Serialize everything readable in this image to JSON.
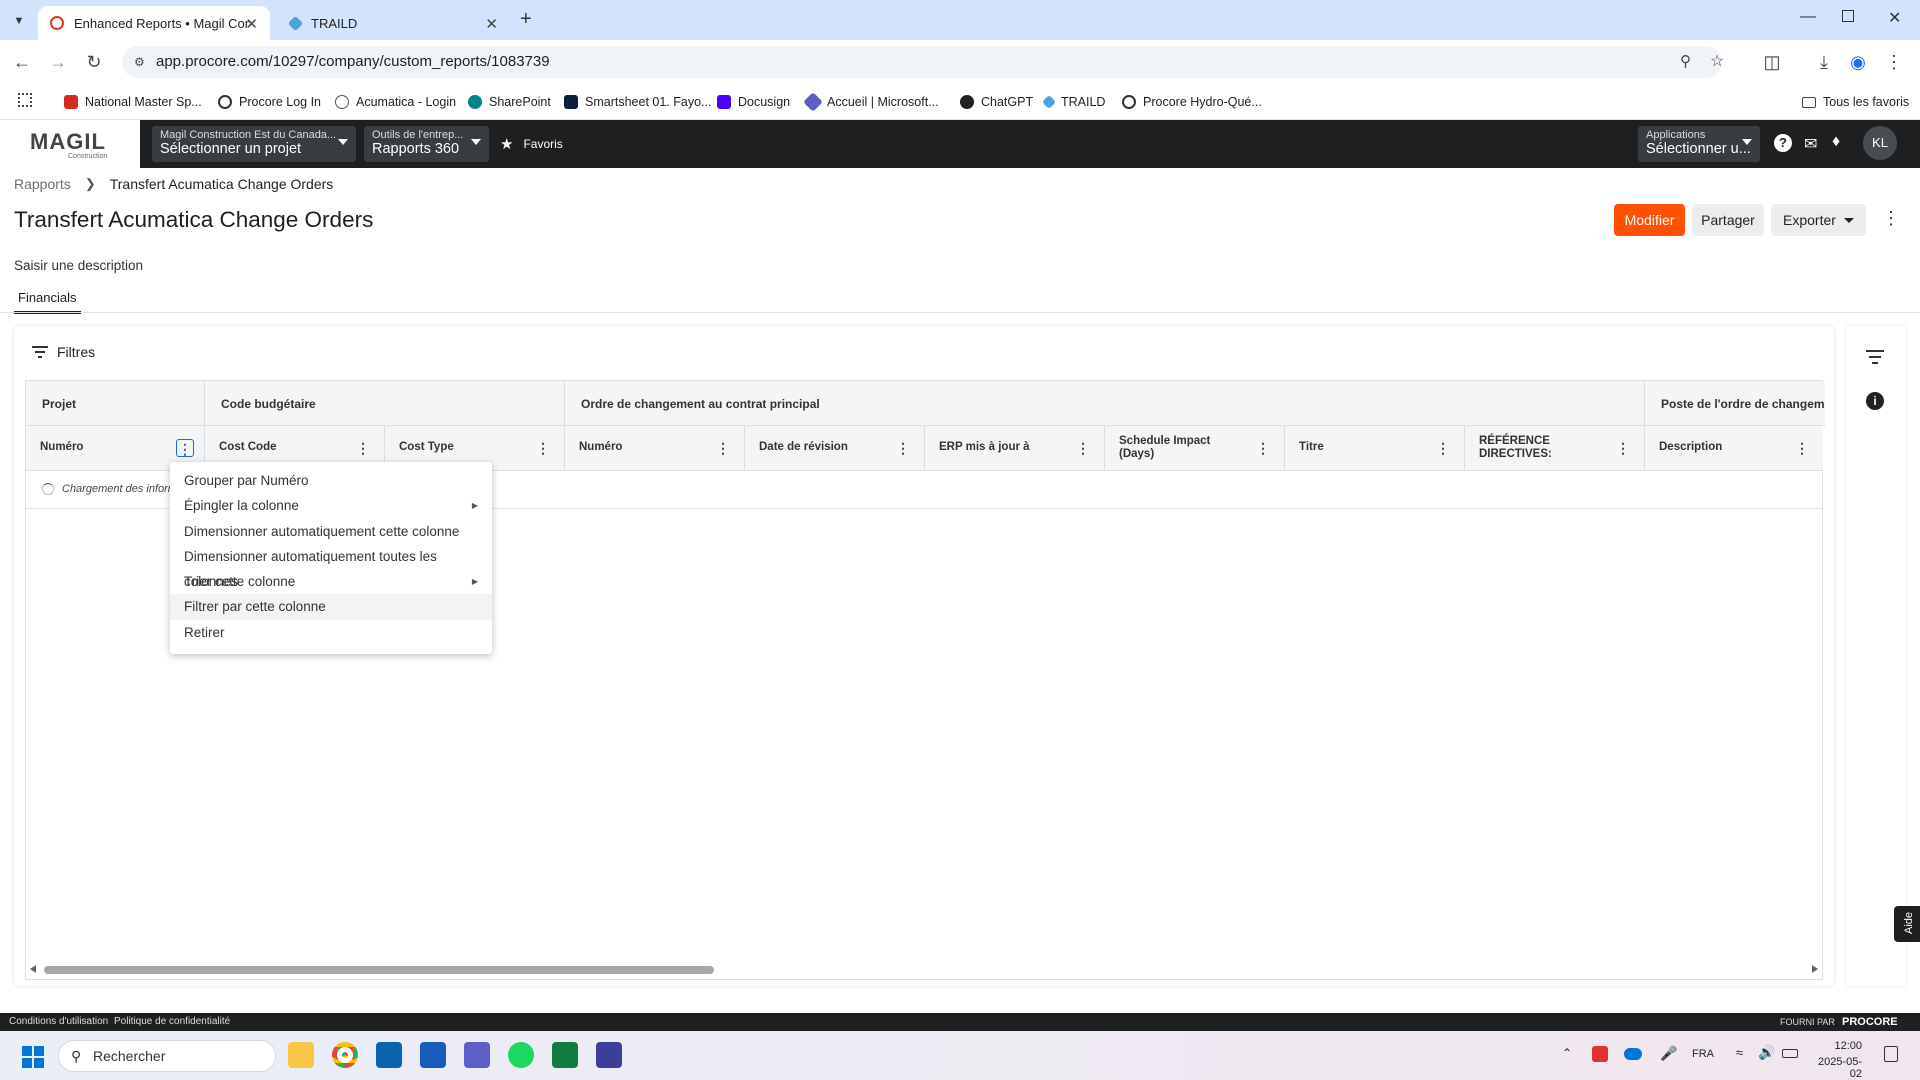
{
  "browser": {
    "tabs": [
      {
        "title": "Enhanced Reports • Magil Cons",
        "active": true
      },
      {
        "title": "TRAILD",
        "active": false
      }
    ],
    "url": "app.procore.com/10297/company/custom_reports/1083739",
    "bookmarks": [
      "National Master Sp...",
      "Procore Log In",
      "Acumatica - Login",
      "SharePoint",
      "Smartsheet 01. Fayo...",
      "Docusign",
      "Accueil | Microsoft...",
      "ChatGPT",
      "TRAILD",
      "Procore Hydro-Qué..."
    ],
    "all_bookmarks": "Tous les favoris"
  },
  "procore_header": {
    "logo_text": "MAGIL",
    "logo_sub": "Construction",
    "company_label": "Magil Construction Est du Canada...",
    "project_value": "Sélectionner un projet",
    "tools_label": "Outils de l'entrep...",
    "tools_value": "Rapports 360",
    "favorites": "Favoris",
    "apps_label": "Applications",
    "apps_value": "Sélectionner u...",
    "avatar": "KL"
  },
  "page": {
    "breadcrumb_root": "Rapports",
    "breadcrumb_current": "Transfert Acumatica Change Orders",
    "title": "Transfert Acumatica Change Orders",
    "description_placeholder": "Saisir une description",
    "tab": "Financials",
    "buttons": {
      "edit": "Modifier",
      "share": "Partager",
      "export": "Exporter"
    }
  },
  "report": {
    "filters_label": "Filtres",
    "group_headers": [
      "Projet",
      "Code budgétaire",
      "Ordre de changement au contrat principal",
      "Poste de l'ordre de changemen"
    ],
    "columns": [
      "Numéro",
      "Cost Code",
      "Cost Type",
      "Numéro",
      "Date de révision",
      "ERP mis à jour à",
      "Schedule Impact (Days)",
      "Titre",
      "RÉFÉRENCE DIRECTIVES:",
      "Description"
    ],
    "loading_text": "Chargement des inform"
  },
  "column_menu": [
    {
      "label": "Grouper par Numéro",
      "submenu": false
    },
    {
      "label": "Épingler la colonne",
      "submenu": true
    },
    {
      "label": "Dimensionner automatiquement cette colonne",
      "submenu": false
    },
    {
      "label": "Dimensionner automatiquement toutes les colonnes",
      "submenu": false
    },
    {
      "label": "Trier cette colonne",
      "submenu": true
    },
    {
      "label": "Filtrer par cette colonne",
      "submenu": false,
      "hovered": true
    },
    {
      "label": "Retirer",
      "submenu": false
    }
  ],
  "footer": {
    "terms": "Conditions d'utilisation",
    "privacy": "Politique de confidentialité",
    "powered": "FOURNI PAR",
    "brand": "PROCORE",
    "help": "Aide"
  },
  "taskbar": {
    "search_placeholder": "Rechercher",
    "language": "FRA",
    "time": "12:00",
    "date": "2025-05-02"
  },
  "colors": {
    "accent_orange": "#ff5200",
    "header_dark": "#1d1f20",
    "selected_blue": "#2066df"
  }
}
